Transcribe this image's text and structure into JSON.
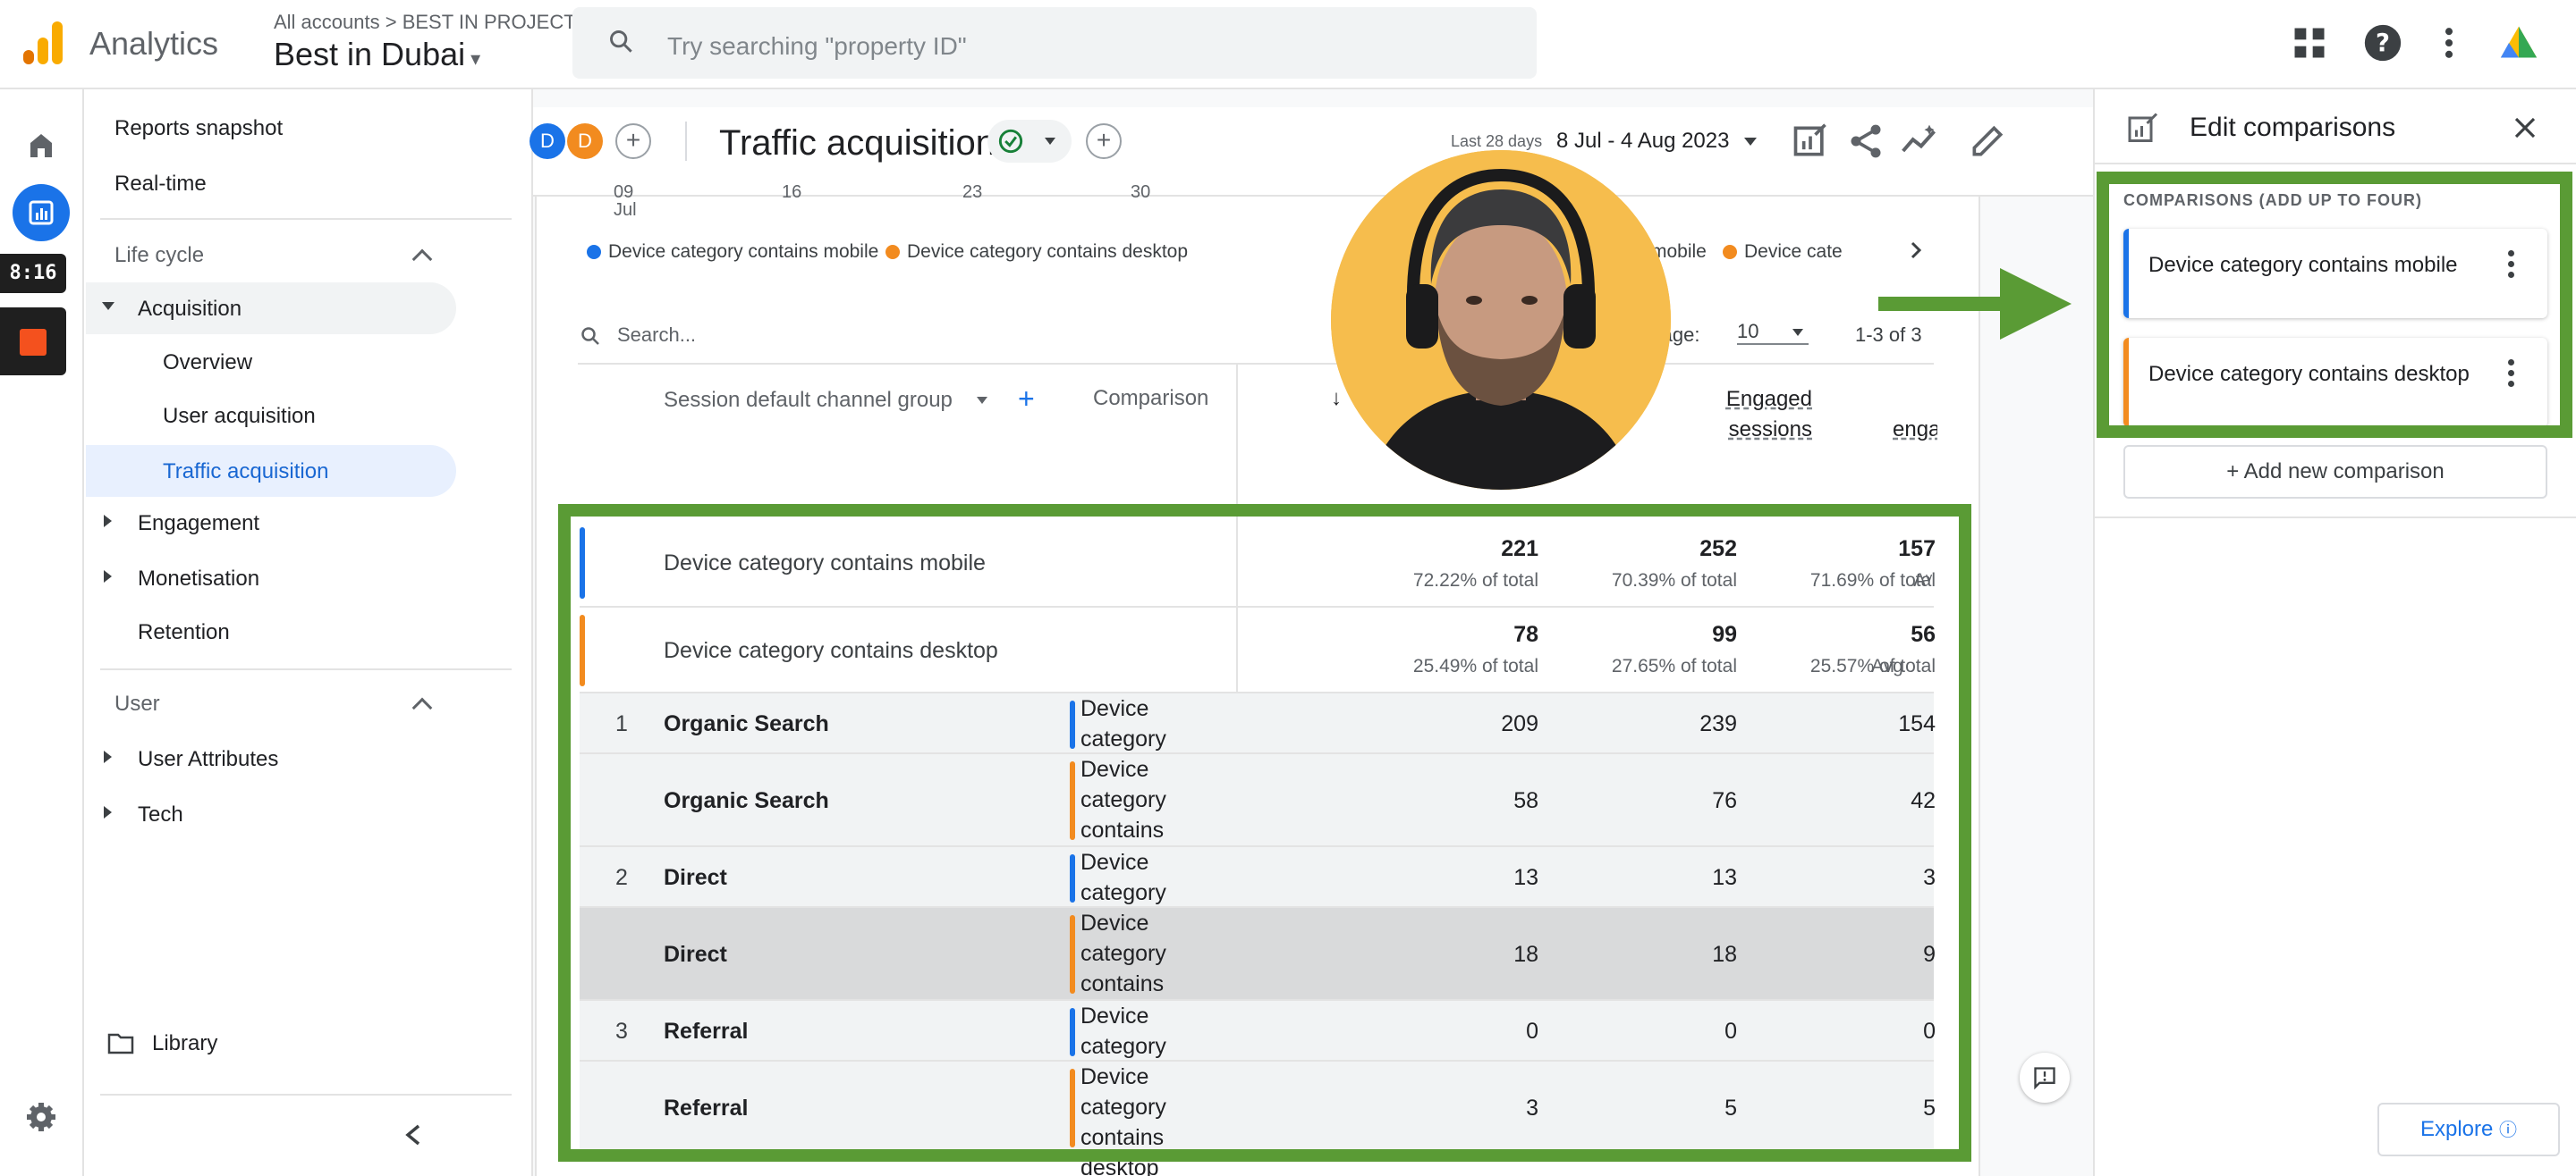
{
  "app": {
    "name": "Analytics",
    "breadcrumb": "All accounts > BEST IN PROJECT",
    "property": "Best in Dubai",
    "search_placeholder": "Try searching \"property ID\""
  },
  "recording": {
    "timer": "8:16"
  },
  "sidenav": {
    "top_items": [
      "Reports snapshot",
      "Real-time"
    ],
    "lifecycle": {
      "title": "Life cycle",
      "acquisition": "Acquisition",
      "acquisition_children": [
        "Overview",
        "User acquisition",
        "Traffic acquisition"
      ],
      "others": [
        "Engagement",
        "Monetisation",
        "Retention"
      ]
    },
    "user": {
      "title": "User",
      "items": [
        "User Attributes",
        "Tech"
      ]
    },
    "library": "Library"
  },
  "report": {
    "title": "Traffic acquisition",
    "avatars": [
      "D",
      "D"
    ],
    "date_label": "Last 28 days",
    "date_range": "8 Jul - 4 Aug 2023",
    "axis_ticks": [
      "09",
      "16",
      "23",
      "30"
    ],
    "axis_month": "Jul",
    "legend": [
      "Device category contains mobile",
      "Device category contains desktop"
    ],
    "legend_partial": [
      "mobile",
      "Device cate"
    ],
    "search_placeholder": "Search...",
    "rows_per_page_label": "r page:",
    "rows_per_page": "10",
    "pagination": "1-3 of 3",
    "columns": {
      "dimension": "Session default channel group",
      "comparison": "Comparison",
      "engaged": "Engaged sessions",
      "partial": "enga"
    },
    "totals": [
      {
        "label": "Device category contains mobile",
        "values": [
          "221",
          "252",
          "157"
        ],
        "subs": [
          "72.22% of total",
          "70.39% of total",
          "71.69% of total"
        ],
        "extra": "Aᵛ"
      },
      {
        "label": "Device category contains desktop",
        "values": [
          "78",
          "99",
          "56"
        ],
        "subs": [
          "25.49% of total",
          "27.65% of total",
          "25.57% of total"
        ],
        "extra": "Avg"
      }
    ],
    "rows": [
      {
        "rank": "1",
        "channel": "Organic Search",
        "comparison": "Device category contains mobile",
        "values": [
          "209",
          "239",
          "154"
        ]
      },
      {
        "rank": "",
        "channel": "Organic Search",
        "comparison": "Device category contains desktop",
        "values": [
          "58",
          "76",
          "42"
        ]
      },
      {
        "rank": "2",
        "channel": "Direct",
        "comparison": "Device category contains mobile",
        "values": [
          "13",
          "13",
          "3"
        ]
      },
      {
        "rank": "",
        "channel": "Direct",
        "comparison": "Device category contains desktop",
        "values": [
          "18",
          "18",
          "9"
        ]
      },
      {
        "rank": "3",
        "channel": "Referral",
        "comparison": "Device category contains mobile",
        "values": [
          "0",
          "0",
          "0"
        ]
      },
      {
        "rank": "",
        "channel": "Referral",
        "comparison": "Device category contains desktop",
        "values": [
          "3",
          "5",
          "5"
        ]
      }
    ]
  },
  "panel": {
    "title": "Edit comparisons",
    "caption": "COMPARISONS (ADD UP TO FOUR)",
    "comparisons": [
      "Device category contains mobile",
      "Device category contains desktop"
    ],
    "add_label": "+ Add new comparison",
    "explore": "Explore"
  },
  "colors": {
    "mobile": "#1a73e8",
    "desktop": "#f28b1f",
    "highlight": "#5a9b35",
    "analytics_orange": "#f9ab00"
  }
}
